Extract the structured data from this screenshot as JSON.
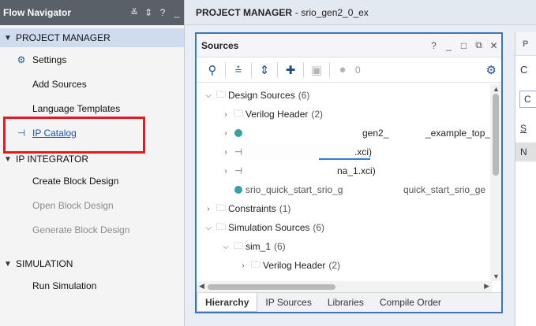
{
  "flow_navigator": {
    "title": "Flow Navigator",
    "header_buttons": [
      "≚",
      "⇕",
      "?",
      "_"
    ],
    "sections": [
      {
        "label": "PROJECT MANAGER",
        "items": [
          {
            "label": "Settings",
            "icon": "gear-icon"
          },
          {
            "label": "Add Sources"
          },
          {
            "label": "Language Templates"
          },
          {
            "label": "IP Catalog",
            "icon": "ip-plug-icon"
          }
        ]
      },
      {
        "label": "IP INTEGRATOR",
        "items": [
          {
            "label": "Create Block Design"
          },
          {
            "label": "Open Block Design"
          },
          {
            "label": "Generate Block Design"
          }
        ]
      },
      {
        "label": "SIMULATION",
        "items": [
          {
            "label": "Run Simulation"
          }
        ]
      }
    ]
  },
  "project_manager": {
    "title": "PROJECT MANAGER",
    "project_name": "- srio_gen2_0_ex"
  },
  "sources": {
    "title": "Sources",
    "window_buttons": [
      "?",
      "_",
      "□",
      "⧉",
      "✕"
    ],
    "toolbar": {
      "status_count": "0"
    },
    "tree": {
      "design_sources": {
        "label": "Design Sources",
        "count": "(6)"
      },
      "verilog_header": {
        "label": "Verilog Header",
        "count": "(2)"
      },
      "partial_top": "_example_top_s",
      "partial_gen": "gen2_",
      "partial_xci_1": ".xci)",
      "partial_xci_2": "na_1.xci)",
      "partial_quick_a": "srio_quick_start_srio_g",
      "partial_quick_b": "quick_start_srio_ge",
      "constraints": {
        "label": "Constraints",
        "count": "(1)"
      },
      "simulation_sources": {
        "label": "Simulation Sources",
        "count": "(6)"
      },
      "sim_1": {
        "label": "sim_1",
        "count": "(6)"
      },
      "sim_verilog_header": {
        "label": "Verilog Header",
        "count": "(2)"
      }
    },
    "tabs": [
      "Hierarchy",
      "IP Sources",
      "Libraries",
      "Compile Order"
    ]
  },
  "side_panel": {
    "header": "P",
    "text1": "C",
    "text2": "C",
    "text3": "S",
    "text4": "N"
  },
  "colors": {
    "nav_header": "#5a6068",
    "selected_section": "#cfdbef",
    "highlight_border": "#e21a22",
    "sources_border": "#3f74b5",
    "link": "#1a55b0"
  }
}
